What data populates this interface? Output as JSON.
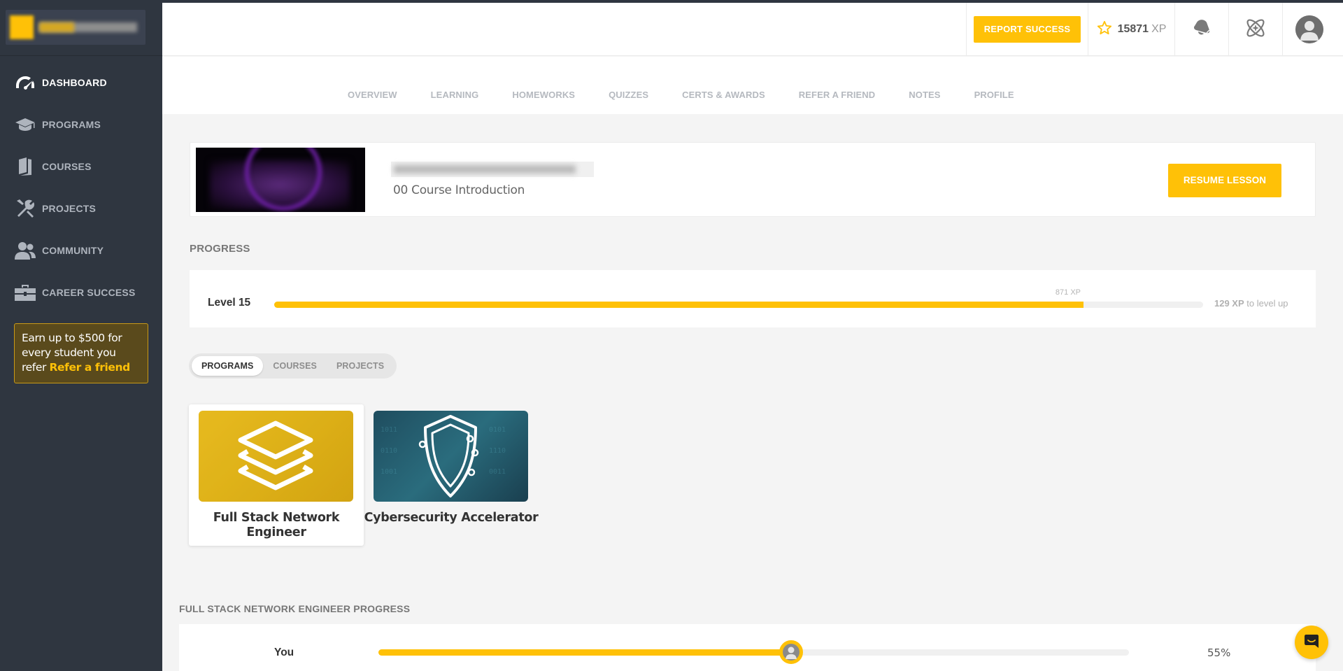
{
  "sidebar": {
    "items": [
      {
        "label": "DASHBOARD",
        "icon": "speedometer-icon",
        "active": true
      },
      {
        "label": "PROGRAMS",
        "icon": "graduation-cap-icon"
      },
      {
        "label": "COURSES",
        "icon": "book-icon"
      },
      {
        "label": "PROJECTS",
        "icon": "tools-icon"
      },
      {
        "label": "COMMUNITY",
        "icon": "people-icon"
      },
      {
        "label": "CAREER SUCCESS",
        "icon": "briefcase-icon"
      }
    ],
    "refer": {
      "text": "Earn up to $500 for every student you refer",
      "link": "Refer a friend"
    }
  },
  "header": {
    "report_button": "REPORT SUCCESS",
    "xp_value": "15871",
    "xp_unit": "XP",
    "icons": [
      "star-icon",
      "bell-icon",
      "atom-icon",
      "avatar-icon"
    ]
  },
  "tabs": [
    "OVERVIEW",
    "LEARNING",
    "HOMEWORKS",
    "QUIZZES",
    "CERTS & AWARDS",
    "REFER A FRIEND",
    "NOTES",
    "PROFILE"
  ],
  "lesson": {
    "subtitle": "00 Course Introduction",
    "resume_button": "RESUME LESSON"
  },
  "progress": {
    "section_title": "PROGRESS",
    "level_label": "Level 15",
    "current_xp_label": "871 XP",
    "fill_fraction": 0.871,
    "to_level_value": "129 XP",
    "to_level_text": " to level up"
  },
  "filters": {
    "options": [
      "PROGRAMS",
      "COURSES",
      "PROJECTS"
    ],
    "selected": "PROGRAMS"
  },
  "programs": [
    {
      "name": "Full Stack Network Engineer",
      "selected": true
    },
    {
      "name": "Cybersecurity Accelerator",
      "selected": false
    }
  ],
  "program_progress": {
    "title": "FULL STACK NETWORK ENGINEER PROGRESS",
    "you_label": "You",
    "percent_label": "55%",
    "fraction": 0.55
  },
  "colors": {
    "accent": "#ffc107",
    "sidebar": "#2f3640"
  }
}
